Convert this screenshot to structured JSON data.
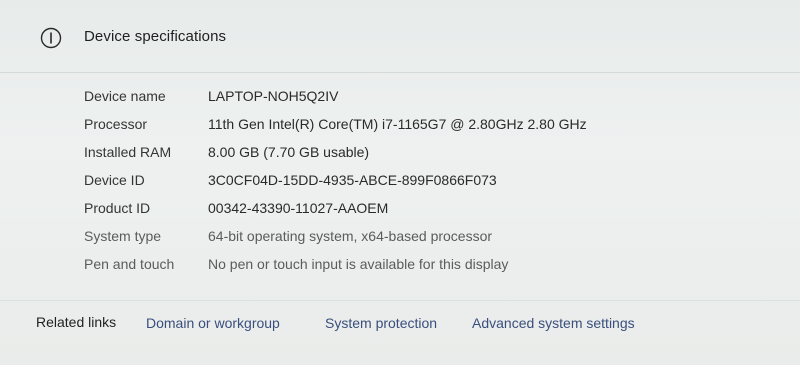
{
  "section": {
    "title": "Device specifications",
    "icon": "info-icon"
  },
  "specs": [
    {
      "label": "Device name",
      "value": "LAPTOP-NOH5Q2IV"
    },
    {
      "label": "Processor",
      "value": "11th Gen Intel(R) Core(TM) i7-1165G7 @ 2.80GHz   2.80 GHz"
    },
    {
      "label": "Installed RAM",
      "value": "8.00 GB (7.70 GB usable)"
    },
    {
      "label": "Device ID",
      "value": "3C0CF04D-15DD-4935-ABCE-899F0866F073"
    },
    {
      "label": "Product ID",
      "value": "00342-43390-11027-AAOEM"
    },
    {
      "label": "System type",
      "value": "64-bit operating system, x64-based processor"
    },
    {
      "label": "Pen and touch",
      "value": "No pen or touch input is available for this display"
    }
  ],
  "related": {
    "title": "Related links",
    "links": [
      {
        "label": "Domain or workgroup"
      },
      {
        "label": "System protection"
      },
      {
        "label": "Advanced system settings"
      }
    ]
  },
  "colors": {
    "background": "#ecefee",
    "text": "#2b2b2b",
    "link": "#3a4f7d"
  }
}
